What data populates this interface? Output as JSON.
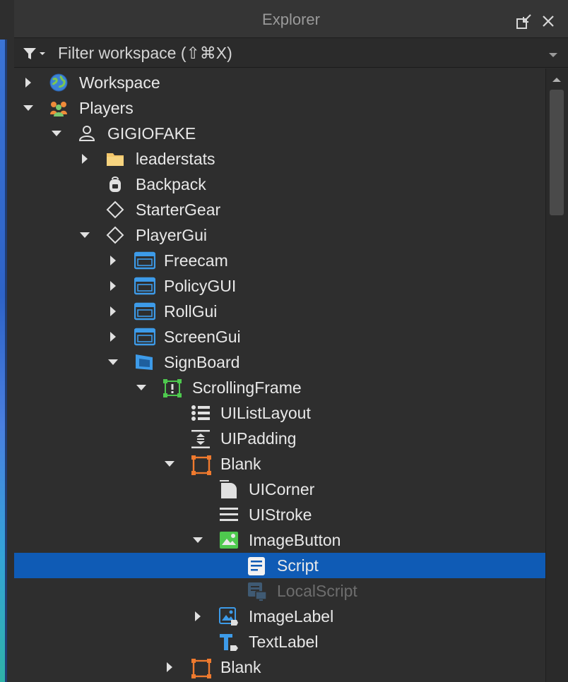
{
  "panel": {
    "title": "Explorer",
    "filter_placeholder": "Filter workspace (⇧⌘X)"
  },
  "tree": [
    {
      "label": "Workspace",
      "icon": "globe-icon",
      "expanded": false,
      "has_children": true
    },
    {
      "label": "Players",
      "icon": "players-icon",
      "expanded": true,
      "has_children": true
    },
    {
      "label": "GIGIOFAKE",
      "icon": "player-icon",
      "expanded": true,
      "has_children": true
    },
    {
      "label": "leaderstats",
      "icon": "folder-icon",
      "expanded": false,
      "has_children": true
    },
    {
      "label": "Backpack",
      "icon": "backpack-icon",
      "has_children": false
    },
    {
      "label": "StarterGear",
      "icon": "diamond-icon",
      "has_children": false
    },
    {
      "label": "PlayerGui",
      "icon": "diamond-icon",
      "expanded": true,
      "has_children": true
    },
    {
      "label": "Freecam",
      "icon": "screengui-icon",
      "expanded": false,
      "has_children": true
    },
    {
      "label": "PolicyGUI",
      "icon": "screengui-icon",
      "expanded": false,
      "has_children": true
    },
    {
      "label": "RollGui",
      "icon": "screengui-icon",
      "expanded": false,
      "has_children": true
    },
    {
      "label": "ScreenGui",
      "icon": "screengui-icon",
      "expanded": false,
      "has_children": true
    },
    {
      "label": "SignBoard",
      "icon": "surfacegui-icon",
      "expanded": true,
      "has_children": true
    },
    {
      "label": "ScrollingFrame",
      "icon": "scrollingframe-icon",
      "expanded": true,
      "has_children": true
    },
    {
      "label": "UIListLayout",
      "icon": "list-layout-icon",
      "has_children": false
    },
    {
      "label": "UIPadding",
      "icon": "padding-icon",
      "has_children": false
    },
    {
      "label": "Blank",
      "icon": "frame-icon",
      "expanded": true,
      "has_children": true
    },
    {
      "label": "UICorner",
      "icon": "corner-icon",
      "has_children": false
    },
    {
      "label": "UIStroke",
      "icon": "stroke-icon",
      "has_children": false
    },
    {
      "label": "ImageButton",
      "icon": "image-button-icon",
      "expanded": true,
      "has_children": true
    },
    {
      "label": "Script",
      "icon": "script-icon",
      "has_children": false,
      "selected": true
    },
    {
      "label": "LocalScript",
      "icon": "local-script-icon",
      "has_children": false,
      "disabled": true
    },
    {
      "label": "ImageLabel",
      "icon": "image-label-icon",
      "expanded": false,
      "has_children": true
    },
    {
      "label": "TextLabel",
      "icon": "text-label-icon",
      "has_children": false
    },
    {
      "label": "Blank",
      "icon": "frame-icon",
      "expanded": false,
      "has_children": true
    }
  ],
  "colors": {
    "background": "#2e2e2e",
    "selection": "#0f5bb5",
    "text": "#e8e8e8",
    "disabled_text": "#6d6d6d"
  }
}
